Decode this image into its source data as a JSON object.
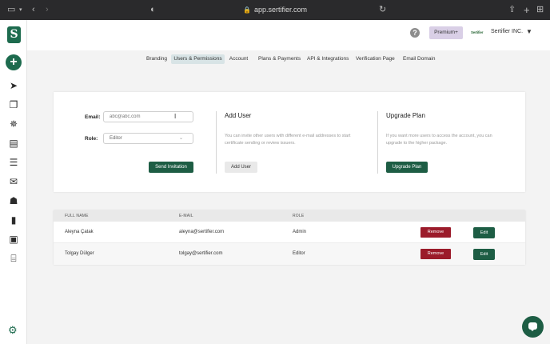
{
  "browser": {
    "url": "app.sertifier.com"
  },
  "sidebar": {
    "logo_letter": "S"
  },
  "header": {
    "help_symbol": "?",
    "premium_label": "Premium+",
    "company_logo_text": "Sertifier",
    "company_name": "Sertifier INC."
  },
  "tabs": [
    {
      "label": "Branding",
      "active": false
    },
    {
      "label": "Users & Permissions",
      "active": true
    },
    {
      "label": "Account",
      "active": false
    },
    {
      "label": "Plans & Payments",
      "active": false
    },
    {
      "label": "API & Integrations",
      "active": false
    },
    {
      "label": "Verification Page",
      "active": false
    },
    {
      "label": "Email Domain",
      "active": false
    }
  ],
  "invite": {
    "email_label": "Email:",
    "email_placeholder": "abc@abc.com",
    "role_label": "Role:",
    "role_value": "Editor",
    "send_label": "Send Invitation",
    "add_user": {
      "title": "Add User",
      "description": "You can invite other users with different e-mail addresses to start certificate sending or review issuers.",
      "button": "Add User"
    },
    "upgrade": {
      "title": "Upgrade Plan",
      "description": "If you want more users to access the account, you can upgrade to the higher package.",
      "button": "Upgrade Plan"
    }
  },
  "table": {
    "headers": [
      "FULL NAME",
      "E-MAIL",
      "ROLE"
    ],
    "remove_label": "Remove",
    "edit_label": "Edit",
    "rows": [
      {
        "name": "Aleyna Çatak",
        "email": "aleyna@sertifier.com",
        "role": "Admin"
      },
      {
        "name": "Tolgay Dülger",
        "email": "tolgay@sertifier.com",
        "role": "Editor"
      }
    ]
  },
  "colors": {
    "brand_green": "#1d5d44",
    "remove_red": "#9b1b2a",
    "premium_purple": "#d9cfe6",
    "active_tab": "#d8e4e6"
  }
}
